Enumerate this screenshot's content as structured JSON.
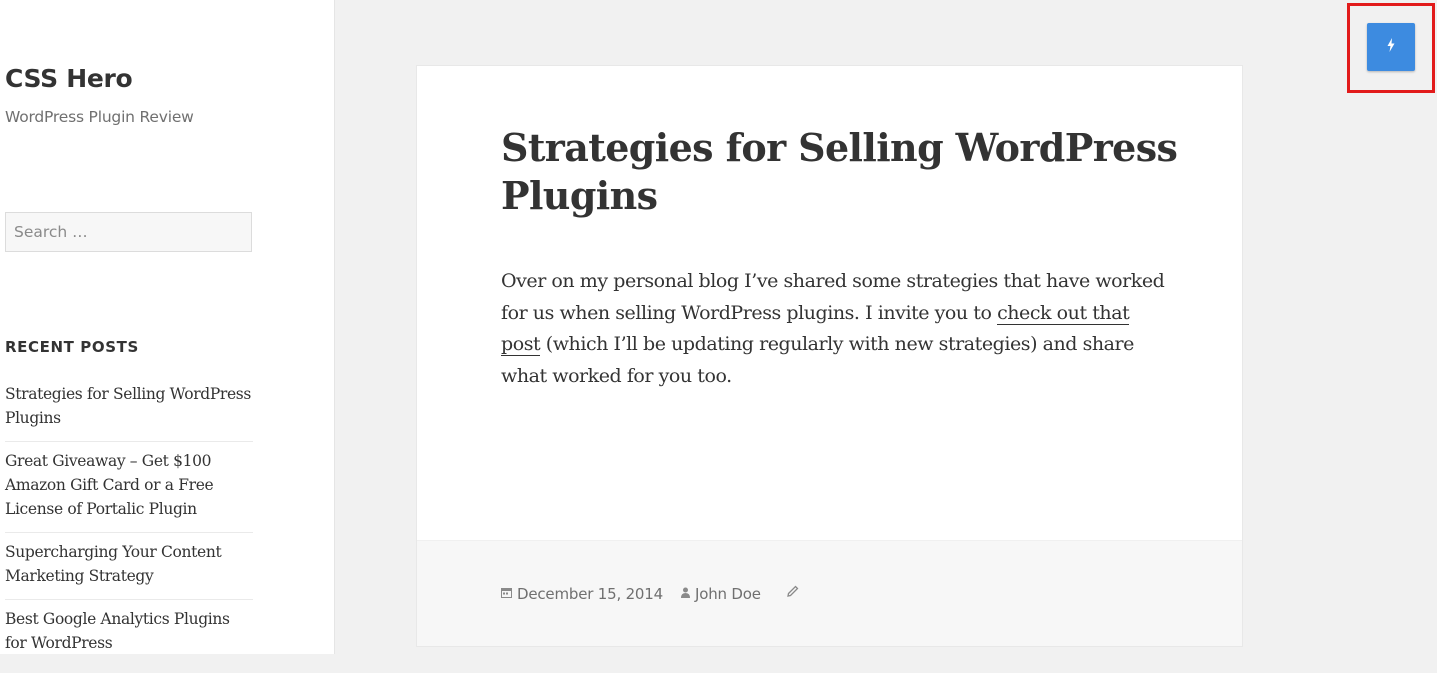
{
  "site": {
    "title": "CSS Hero",
    "description": "WordPress Plugin Review"
  },
  "sidebar": {
    "search_placeholder": "Search …",
    "recent_posts": {
      "heading": "RECENT POSTS",
      "items": [
        "Strategies for Selling WordPress Plugins",
        "Great Giveaway – Get $100 Amazon Gift Card or a Free License of Portalic Plugin",
        "Supercharging Your Content Marketing Strategy",
        "Best Google Analytics Plugins for WordPress"
      ]
    }
  },
  "article": {
    "title": "Strategies for Selling WordPress Plugins",
    "body_before_link": "Over on my personal blog I’ve shared some strategies that have worked for us when selling WordPress plugins. I invite you to ",
    "link_text": "check out that post",
    "body_after_link": " (which I’ll be updating regularly with new strategies) and share what worked for you too.",
    "meta": {
      "date": "December 15, 2014",
      "author": "John Doe",
      "date_icon": "calendar-icon",
      "author_icon": "user-icon",
      "edit_icon": "pencil-icon"
    }
  },
  "floating_button": {
    "icon": "lightning-bolt-icon",
    "color": "#3d8be0",
    "highlight_color": "#e21b1b"
  }
}
